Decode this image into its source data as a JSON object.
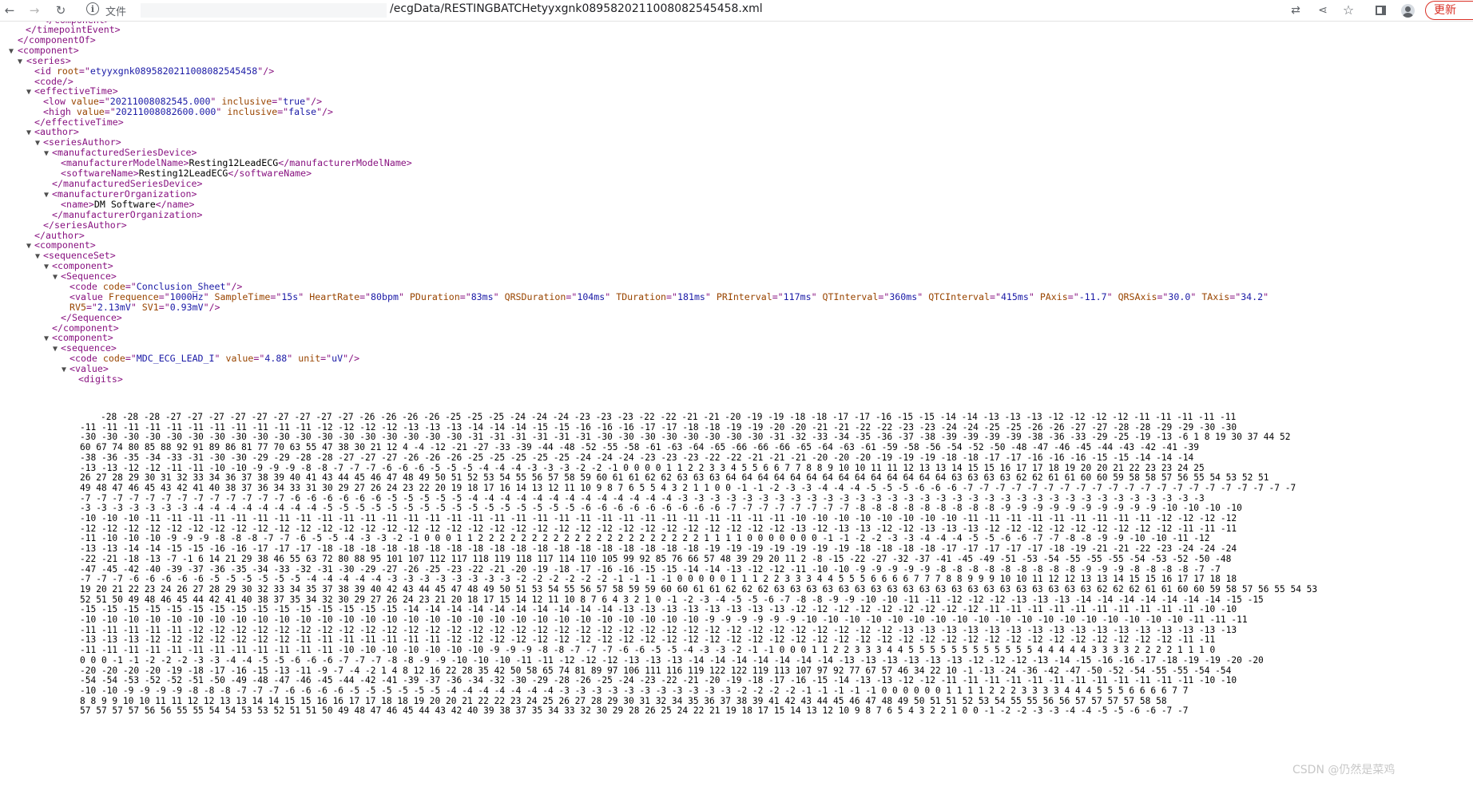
{
  "browser": {
    "security_label": "文件",
    "url_text": "/ecgData/RESTINGBATCHetyyxgnk0895820211008082545458.xml",
    "update_label": "更新"
  },
  "xml": {
    "series_id_root": "etyyxgnk0895820211008082545458",
    "effective_low": "20211008082545.000",
    "effective_low_inclusive": "true",
    "effective_high": "20211008082600.000",
    "effective_high_inclusive": "false",
    "model_name": "Resting12LeadECG",
    "software_name": "Resting12LeadECG",
    "org_name": "DM Software",
    "conclusion_code": "Conclusion_Sheet",
    "value_attrs": [
      {
        "name": "Frequence",
        "value": "1000Hz"
      },
      {
        "name": "SampleTime",
        "value": "15s"
      },
      {
        "name": "HeartRate",
        "value": "80bpm"
      },
      {
        "name": "PDuration",
        "value": "83ms"
      },
      {
        "name": "QRSDuration",
        "value": "104ms"
      },
      {
        "name": "TDuration",
        "value": "181ms"
      },
      {
        "name": "PRInterval",
        "value": "117ms"
      },
      {
        "name": "QTInterval",
        "value": "360ms"
      },
      {
        "name": "QTCInterval",
        "value": "415ms"
      },
      {
        "name": "PAxis",
        "value": "-11.7"
      },
      {
        "name": "QRSAxis",
        "value": "30.0"
      },
      {
        "name": "TAxis",
        "value": "34.2"
      }
    ],
    "value_attrs_line2": [
      {
        "name": "RV5",
        "value": "2.13mV"
      },
      {
        "name": "SV1",
        "value": "0.93mV"
      }
    ],
    "lead_code": "MDC_ECG_LEAD_I",
    "lead_value": "4.88",
    "lead_unit": "uV",
    "digits_rows": [
      "-28 -28 -28 -27 -27 -27 -27 -27 -27 -27 -27 -27 -26 -26 -26 -26 -25 -25 -25 -24 -24 -24 -23 -23 -23 -22 -22 -21 -21 -20 -19 -19 -18 -18 -17 -17 -16 -15 -15 -14 -14 -13 -13 -13 -12 -12 -12 -12 -11 -11 -11 -11 -11",
      "-11 -11 -11 -11 -11 -11 -11 -11 -11 -11 -11 -12 -12 -12 -12 -13 -13 -13 -14 -14 -14 -15 -15 -16 -16 -16 -17 -17 -18 -18 -19 -19 -20 -20 -21 -21 -22 -22 -23 -23 -24 -24 -25 -25 -26 -26 -27 -27 -28 -28 -29 -29 -30 -30",
      "-30 -30 -30 -30 -30 -30 -30 -30 -30 -30 -30 -30 -30 -30 -30 -30 -30 -30 -31 -31 -31 -31 -31 -31 -30 -30 -30 -30 -30 -30 -30 -30 -31 -32 -33 -34 -35 -36 -37 -38 -39 -39 -39 -39 -38 -36 -33 -29 -25 -19 -13 -6 1 8 19 30 37 44 52",
      "60 67 74 80 85 88 92 91 89 86 81 77 70 63 55 47 38 30 21 12 4 -4 -12 -21 -27 -33 -39 -44 -48 -52 -55 -58 -61 -63 -64 -65 -66 -66 -66 -65 -64 -63 -61 -59 -58 -56 -54 -52 -50 -48 -47 -46 -45 -44 -43 -42 -41 -39",
      "-38 -36 -35 -34 -33 -31 -30 -30 -29 -29 -28 -28 -27 -27 -27 -26 -26 -26 -25 -25 -25 -25 -25 -24 -24 -24 -23 -23 -23 -22 -22 -21 -21 -21 -20 -20 -20 -19 -19 -19 -18 -18 -17 -17 -16 -16 -16 -15 -15 -14 -14 -14",
      "-13 -13 -12 -12 -11 -11 -10 -10 -9 -9 -9 -8 -8 -7 -7 -7 -6 -6 -6 -5 -5 -5 -4 -4 -4 -3 -3 -3 -2 -2 -1 0 0 0 0 1 1 2 2 3 3 4 5 5 6 6 7 7 8 8 9 10 10 11 11 12 13 13 14 15 15 16 17 17 18 19 20 20 21 22 23 23 24 25",
      "26 27 28 29 30 31 32 33 34 36 37 38 39 40 41 43 44 45 46 47 48 49 50 51 52 53 54 55 56 57 58 59 60 61 61 62 62 63 63 63 64 64 64 64 64 64 64 64 64 64 64 64 64 64 63 63 63 63 62 62 61 61 60 60 59 58 58 57 56 55 54 53 52 51",
      "49 48 47 46 45 43 42 41 40 38 37 36 34 33 31 30 29 27 26 24 23 22 20 19 18 17 16 14 13 12 11 10 9 8 7 6 5 5 4 3 2 1 1 0 0 -1 -1 -2 -3 -3 -4 -4 -4 -5 -5 -5 -6 -6 -6 -7 -7 -7 -7 -7 -7 -7 -7 -7 -7 -7 -7 -7 -7 -7 -7 -7 -7 -7 -7 -7",
      "-7 -7 -7 -7 -7 -7 -7 -7 -7 -7 -7 -7 -7 -6 -6 -6 -6 -6 -6 -5 -5 -5 -5 -5 -4 -4 -4 -4 -4 -4 -4 -4 -4 -4 -4 -4 -4 -3 -3 -3 -3 -3 -3 -3 -3 -3 -3 -3 -3 -3 -3 -3 -3 -3 -3 -3 -3 -3 -3 -3 -3 -3 -3 -3 -3 -3 -3 -3 -3 -3",
      "-3 -3 -3 -3 -3 -3 -3 -4 -4 -4 -4 -4 -4 -4 -4 -5 -5 -5 -5 -5 -5 -5 -5 -5 -5 -5 -5 -5 -5 -5 -5 -6 -6 -6 -6 -6 -6 -6 -6 -6 -7 -7 -7 -7 -7 -7 -7 -7 -8 -8 -8 -8 -8 -8 -8 -8 -8 -9 -9 -9 -9 -9 -9 -9 -9 -9 -9 -10 -10 -10 -10",
      "-10 -10 -10 -11 -11 -11 -11 -11 -11 -11 -11 -11 -11 -11 -11 -11 -11 -11 -11 -11 -11 -11 -11 -11 -11 -11 -11 -11 -11 -11 -11 -11 -11 -10 -10 -10 -10 -10 -10 -10 -10 -11 -11 -11 -11 -11 -11 -11 -11 -11 -12 -12 -12 -12",
      "-12 -12 -12 -12 -12 -12 -12 -12 -12 -12 -12 -12 -12 -12 -12 -12 -12 -12 -12 -12 -12 -12 -12 -12 -12 -12 -12 -12 -12 -12 -12 -12 -12 -13 -12 -13 -13 -12 -12 -13 -13 -13 -12 -12 -12 -12 -12 -12 -12 -12 -12 -11 -11 -11",
      "-11 -10 -10 -10 -9 -9 -9 -8 -8 -8 -7 -7 -6 -5 -5 -4 -3 -3 -2 -1 0 0 0 1 1 2 2 2 2 2 2 2 2 2 2 2 2 2 2 2 2 2 2 2 2 2 1 1 1 1 0 0 0 0 0 0 0 -1 -1 -2 -2 -3 -3 -4 -4 -4 -5 -5 -6 -6 -7 -7 -8 -8 -9 -9 -10 -10 -11 -12",
      "-13 -13 -14 -14 -15 -15 -16 -16 -17 -17 -17 -18 -18 -18 -18 -18 -18 -18 -18 -18 -18 -18 -18 -18 -18 -18 -18 -18 -18 -19 -19 -19 -19 -19 -19 -19 -18 -18 -18 -18 -17 -17 -17 -17 -17 -18 -19 -21 -21 -22 -23 -24 -24 -24",
      "-22 -21 -18 -13 -7 -1 6 14 21 29 38 46 55 63 72 80 88 95 101 107 112 117 118 119 118 117 114 110 105 99 92 85 76 66 57 48 39 29 20 11 2 -8 -15 -22 -27 -32 -37 -41 -45 -49 -51 -53 -54 -55 -55 -55 -54 -53 -52 -50 -48",
      "-47 -45 -42 -40 -39 -37 -36 -35 -34 -33 -32 -31 -30 -29 -27 -26 -25 -23 -22 -21 -20 -19 -18 -17 -16 -16 -15 -15 -14 -14 -13 -12 -12 -11 -10 -10 -9 -9 -9 -9 -9 -8 -8 -8 -8 -8 -8 -8 -8 -8 -9 -9 -9 -8 -8 -8 -8 -7 -7",
      "-7 -7 -7 -6 -6 -6 -6 -6 -5 -5 -5 -5 -5 -5 -4 -4 -4 -4 -4 -3 -3 -3 -3 -3 -3 -3 -3 -2 -2 -2 -2 -2 -2 -1 -1 -1 -1 0 0 0 0 0 1 1 1 2 2 3 3 3 4 4 5 5 5 6 6 6 6 7 7 7 8 8 9 9 9 10 10 11 12 12 13 13 14 15 15 16 17 17 18 18",
      "19 20 21 22 23 24 26 27 28 29 30 32 33 34 35 37 38 39 40 42 43 44 45 47 48 49 50 51 53 54 55 56 57 58 59 59 60 60 61 61 62 62 62 63 63 63 63 63 63 63 63 63 63 63 63 63 63 63 63 63 63 63 63 62 62 62 61 61 60 60 59 58 57 56 55 54 53",
      "52 51 50 49 48 46 45 44 42 41 40 38 37 35 34 32 30 29 27 26 24 23 21 20 18 17 15 14 12 11 10 8 7 6 4 3 2 1 0 -1 -2 -3 -4 -5 -5 -6 -7 -8 -8 -9 -9 -10 -10 -11 -11 -12 -12 -12 -13 -13 -13 -14 -14 -14 -14 -14 -14 -14 -15 -15",
      "-15 -15 -15 -15 -15 -15 -15 -15 -15 -15 -15 -15 -15 -15 -15 -14 -14 -14 -14 -14 -14 -14 -14 -14 -14 -13 -13 -13 -13 -13 -13 -13 -13 -12 -12 -12 -12 -12 -12 -12 -12 -12 -11 -11 -11 -11 -11 -11 -11 -11 -11 -11 -10 -10",
      "-10 -10 -10 -10 -10 -10 -10 -10 -10 -10 -10 -10 -10 -10 -10 -10 -10 -10 -10 -10 -10 -10 -10 -10 -10 -10 -10 -10 -10 -9 -9 -9 -9 -9 -9 -10 -10 -10 -10 -10 -10 -10 -10 -10 -10 -10 -10 -10 -10 -10 -10 -10 -10 -11 -11 -11",
      "-11 -11 -11 -11 -11 -12 -12 -12 -12 -12 -12 -12 -12 -12 -12 -12 -12 -12 -12 -12 -12 -12 -12 -12 -12 -12 -12 -12 -12 -12 -12 -12 -12 -12 -12 -12 -12 -12 -13 -13 -13 -13 -13 -13 -13 -13 -13 -13 -13 -13 -13 -13 -13 -13",
      "-13 -13 -13 -12 -12 -12 -12 -12 -12 -12 -11 -11 -11 -11 -11 -11 -11 -12 -12 -12 -12 -12 -12 -12 -12 -12 -12 -12 -12 -12 -12 -12 -12 -12 -12 -12 -12 -12 -12 -12 -12 -12 -12 -12 -12 -12 -12 -12 -12 -12 -12 -11 -11",
      "-11 -11 -11 -11 -11 -11 -11 -11 -11 -11 -11 -11 -10 -10 -10 -10 -10 -10 -10 -9 -9 -9 -8 -8 -7 -7 -7 -6 -6 -5 -5 -4 -3 -3 -2 -1 -1 0 0 0 1 1 2 2 3 3 3 4 4 5 5 5 5 5 5 5 5 5 5 5 5 4 4 4 4 4 3 3 3 3 2 2 2 2 1 1 1 0",
      "0 0 0 -1 -1 -2 -2 -2 -3 -3 -4 -4 -5 -5 -6 -6 -6 -7 -7 -7 -8 -8 -9 -9 -10 -10 -10 -11 -11 -12 -12 -12 -13 -13 -13 -14 -14 -14 -14 -14 -14 -14 -13 -13 -13 -13 -13 -13 -12 -12 -12 -13 -14 -15 -16 -16 -17 -18 -19 -19 -20 -20",
      "-20 -20 -20 -20 -19 -18 -17 -16 -15 -13 -11 -9 -7 -4 -2 1 4 8 12 16 22 28 35 42 50 58 65 74 81 89 97 106 111 116 119 122 122 119 113 107 97 92 77 67 57 46 34 22 10 -1 -13 -24 -36 -42 -47 -50 -52 -54 -55 -55 -54 -54",
      "-54 -54 -53 -52 -52 -51 -50 -49 -48 -47 -46 -45 -44 -42 -41 -39 -37 -36 -34 -32 -30 -29 -28 -26 -25 -24 -23 -22 -21 -20 -19 -18 -17 -16 -15 -14 -13 -13 -12 -12 -11 -11 -11 -11 -11 -11 -11 -11 -11 -11 -11 -11 -10 -10",
      "-10 -10 -9 -9 -9 -9 -8 -8 -8 -7 -7 -7 -6 -6 -6 -6 -5 -5 -5 -5 -5 -5 -4 -4 -4 -4 -4 -4 -4 -3 -3 -3 -3 -3 -3 -3 -3 -3 -3 -3 -2 -2 -2 -2 -1 -1 -1 -1 -1 0 0 0 0 0 0 1 1 1 1 2 2 2 3 3 3 3 4 4 4 5 5 5 6 6 6 6 7 7",
      "8 8 9 9 10 10 11 11 12 12 13 13 14 14 15 15 16 16 17 17 18 18 19 20 20 21 22 22 23 24 25 26 27 28 29 30 31 32 34 35 36 37 38 39 41 42 43 44 45 46 47 48 49 50 51 51 52 53 54 55 55 56 56 57 57 57 57 58 58",
      "57 57 57 57 56 56 55 55 54 54 53 53 52 51 51 50 49 48 47 46 45 44 43 42 40 39 38 37 35 34 33 32 30 29 28 26 25 24 22 21 19 18 17 15 14 13 12 10 9 8 7 6 5 4 3 2 2 1 0 0 -1 -2 -2 -3 -3 -4 -4 -5 -5 -6 -6 -7 -7"
    ]
  }
}
